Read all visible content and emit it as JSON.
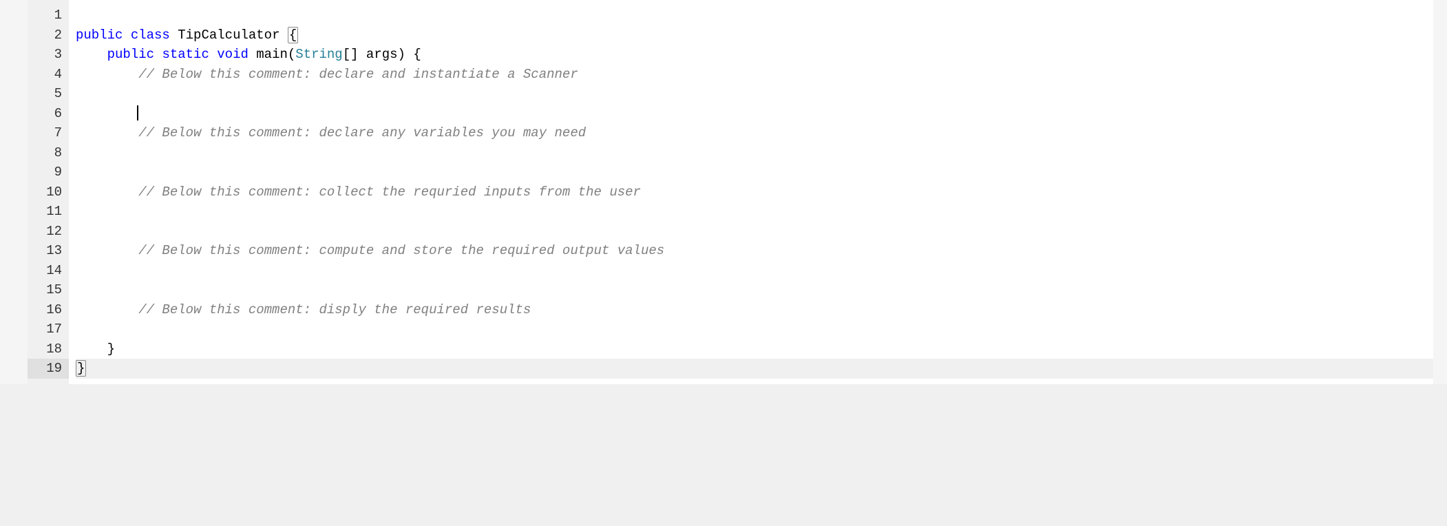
{
  "editor": {
    "lines": [
      {
        "num": "1",
        "content": "",
        "tokens": []
      },
      {
        "num": "2",
        "content": "public class TipCalculator {",
        "tokens": [
          {
            "t": "public",
            "c": "kw"
          },
          {
            "t": " ",
            "c": ""
          },
          {
            "t": "class",
            "c": "kw"
          },
          {
            "t": " ",
            "c": ""
          },
          {
            "t": "TipCalculator",
            "c": "cls"
          },
          {
            "t": " ",
            "c": ""
          },
          {
            "t": "{",
            "c": "punct bracket-match"
          }
        ]
      },
      {
        "num": "3",
        "content": "    public static void main(String[] args) {",
        "tokens": [
          {
            "t": "    ",
            "c": ""
          },
          {
            "t": "public",
            "c": "kw"
          },
          {
            "t": " ",
            "c": ""
          },
          {
            "t": "static",
            "c": "kw"
          },
          {
            "t": " ",
            "c": ""
          },
          {
            "t": "void",
            "c": "kw"
          },
          {
            "t": " ",
            "c": ""
          },
          {
            "t": "main(",
            "c": "method"
          },
          {
            "t": "String",
            "c": "type"
          },
          {
            "t": "[] args) {",
            "c": "param"
          }
        ]
      },
      {
        "num": "4",
        "content": "        // Below this comment: declare and instantiate a Scanner",
        "tokens": [
          {
            "t": "        ",
            "c": ""
          },
          {
            "t": "// Below this comment: declare and instantiate a Scanner",
            "c": "comment"
          }
        ]
      },
      {
        "num": "5",
        "content": "",
        "tokens": []
      },
      {
        "num": "6",
        "content": "        ",
        "tokens": [
          {
            "t": "        ",
            "c": ""
          }
        ],
        "cursor": true
      },
      {
        "num": "7",
        "content": "        // Below this comment: declare any variables you may need",
        "tokens": [
          {
            "t": "        ",
            "c": ""
          },
          {
            "t": "// Below this comment: declare any variables you may need",
            "c": "comment"
          }
        ]
      },
      {
        "num": "8",
        "content": "",
        "tokens": []
      },
      {
        "num": "9",
        "content": "",
        "tokens": []
      },
      {
        "num": "10",
        "content": "        // Below this comment: collect the requried inputs from the user",
        "tokens": [
          {
            "t": "        ",
            "c": ""
          },
          {
            "t": "// Below this comment: collect the requried inputs from the user",
            "c": "comment"
          }
        ]
      },
      {
        "num": "11",
        "content": "",
        "tokens": []
      },
      {
        "num": "12",
        "content": "",
        "tokens": []
      },
      {
        "num": "13",
        "content": "        // Below this comment: compute and store the required output values",
        "tokens": [
          {
            "t": "        ",
            "c": ""
          },
          {
            "t": "// Below this comment: compute and store the required output values",
            "c": "comment"
          }
        ]
      },
      {
        "num": "14",
        "content": "",
        "tokens": []
      },
      {
        "num": "15",
        "content": "",
        "tokens": []
      },
      {
        "num": "16",
        "content": "        // Below this comment: disply the required results",
        "tokens": [
          {
            "t": "        ",
            "c": ""
          },
          {
            "t": "// Below this comment: disply the required results",
            "c": "comment"
          }
        ]
      },
      {
        "num": "17",
        "content": "",
        "tokens": []
      },
      {
        "num": "18",
        "content": "    }",
        "tokens": [
          {
            "t": "    }",
            "c": "punct"
          }
        ]
      },
      {
        "num": "19",
        "content": "}",
        "tokens": [
          {
            "t": "}",
            "c": "punct bracket-match"
          }
        ],
        "current": true
      }
    ]
  }
}
